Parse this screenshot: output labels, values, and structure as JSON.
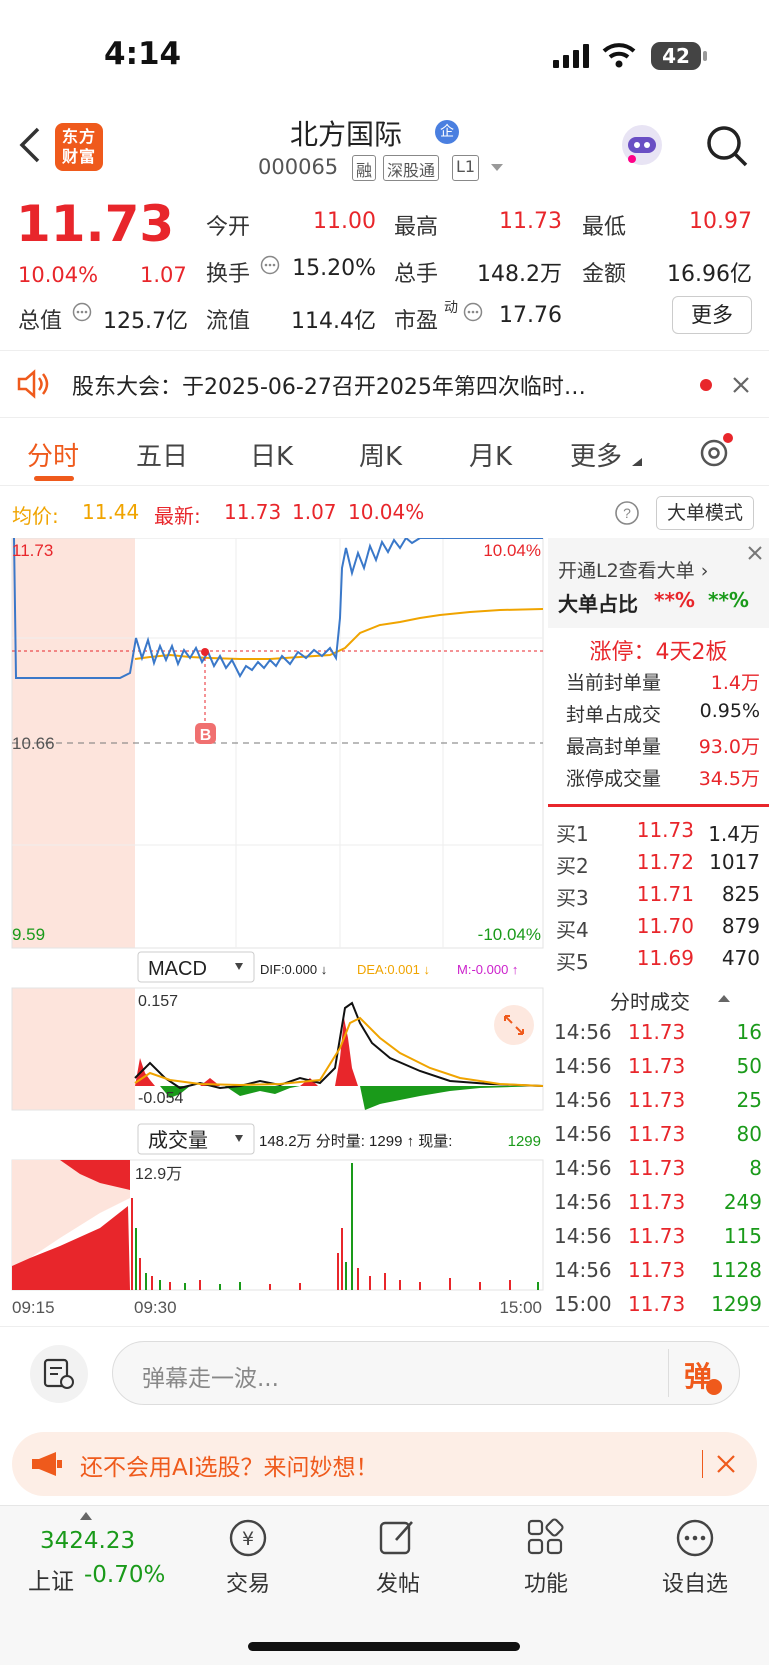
{
  "status_bar": {
    "time": "4:14",
    "battery": "42"
  },
  "header": {
    "logo_text": "东方财富",
    "stock_name": "北方国际",
    "badge": "企",
    "code": "000065",
    "tags": [
      "融",
      "深股通",
      "L1"
    ]
  },
  "quote": {
    "price": "11.73",
    "pct": "10.04%",
    "change": "1.07",
    "fields": [
      {
        "label": "今开",
        "value": "11.00",
        "color": "#e8262b"
      },
      {
        "label": "最高",
        "value": "11.73",
        "color": "#e8262b"
      },
      {
        "label": "最低",
        "value": "10.97",
        "color": "#e8262b"
      },
      {
        "label": "换手",
        "value": "15.20%",
        "color": "#222"
      },
      {
        "label": "总手",
        "value": "148.2万",
        "color": "#222"
      },
      {
        "label": "金额",
        "value": "16.96亿",
        "color": "#222"
      },
      {
        "label": "总值",
        "value": "125.7亿",
        "color": "#222"
      },
      {
        "label": "流值",
        "value": "114.4亿",
        "color": "#222"
      },
      {
        "label": "市盈",
        "value": "17.76",
        "color": "#222"
      }
    ],
    "pe_sup": "动",
    "more_button": "更多"
  },
  "notice": {
    "text": "股东大会：于2025-06-27召开2025年第四次临时…"
  },
  "tabs": [
    "分时",
    "五日",
    "日K",
    "周K",
    "月K",
    "更多"
  ],
  "priceline": {
    "avg_label": "均价:",
    "avg_value": "11.44",
    "latest_label": "最新:",
    "latest_value": "11.73",
    "latest_change": "1.07",
    "latest_pct": "10.04%",
    "mode_button": "大单模式"
  },
  "chart_labels": {
    "top": "11.73",
    "mid": "10.66",
    "bottom": "9.59",
    "top_pct": "10.04%",
    "bottom_pct": "-10.04%",
    "b_marker": "B",
    "macd_select": "MACD",
    "dif": "DIF:0.000 ↓",
    "dea": "DEA:0.001 ↓",
    "m": "M:-0.000 ↑",
    "macd_top": "0.157",
    "macd_bottom": "-0.054",
    "vol_select": "成交量",
    "vol_info": "148.2万 分时量: 1299 ↑ 现量:",
    "vol_now": "1299",
    "vol_max": "12.9万",
    "t1": "09:15",
    "t2": "09:30",
    "t3": "15:00"
  },
  "side": {
    "l2_link": "开通L2查看大单 ›",
    "big_ratio_label": "大单占比",
    "big_ratio_v1": "**%",
    "big_ratio_v2": "**%",
    "limit_title": "涨停：4天2板",
    "limit_rows": [
      {
        "label": "当前封单量",
        "value": "1.4万"
      },
      {
        "label": "封单占成交",
        "value": "0.95%"
      },
      {
        "label": "最高封单量",
        "value": "93.0万"
      },
      {
        "label": "涨停成交量",
        "value": "34.5万"
      }
    ],
    "bids": [
      {
        "label": "买1",
        "price": "11.73",
        "vol": "1.4万"
      },
      {
        "label": "买2",
        "price": "11.72",
        "vol": "1017"
      },
      {
        "label": "买3",
        "price": "11.71",
        "vol": "825"
      },
      {
        "label": "买4",
        "price": "11.70",
        "vol": "879"
      },
      {
        "label": "买5",
        "price": "11.69",
        "vol": "470"
      }
    ],
    "ticks_title": "分时成交",
    "ticks": [
      {
        "t": "14:56",
        "p": "11.73",
        "v": "16"
      },
      {
        "t": "14:56",
        "p": "11.73",
        "v": "50"
      },
      {
        "t": "14:56",
        "p": "11.73",
        "v": "25"
      },
      {
        "t": "14:56",
        "p": "11.73",
        "v": "80"
      },
      {
        "t": "14:56",
        "p": "11.73",
        "v": "8"
      },
      {
        "t": "14:56",
        "p": "11.73",
        "v": "249"
      },
      {
        "t": "14:56",
        "p": "11.73",
        "v": "115"
      },
      {
        "t": "14:56",
        "p": "11.73",
        "v": "1128"
      },
      {
        "t": "15:00",
        "p": "11.73",
        "v": "1299"
      }
    ]
  },
  "danmu": {
    "placeholder": "弹幕走一波...",
    "send": "弹"
  },
  "ai_bar": {
    "text": "还不会用AI选股？来问妙想！"
  },
  "bottom_nav": {
    "index_value": "3424.23",
    "index_name": "上证",
    "index_pct": "-0.70%",
    "items": [
      "交易",
      "发帖",
      "功能",
      "设自选"
    ]
  }
}
